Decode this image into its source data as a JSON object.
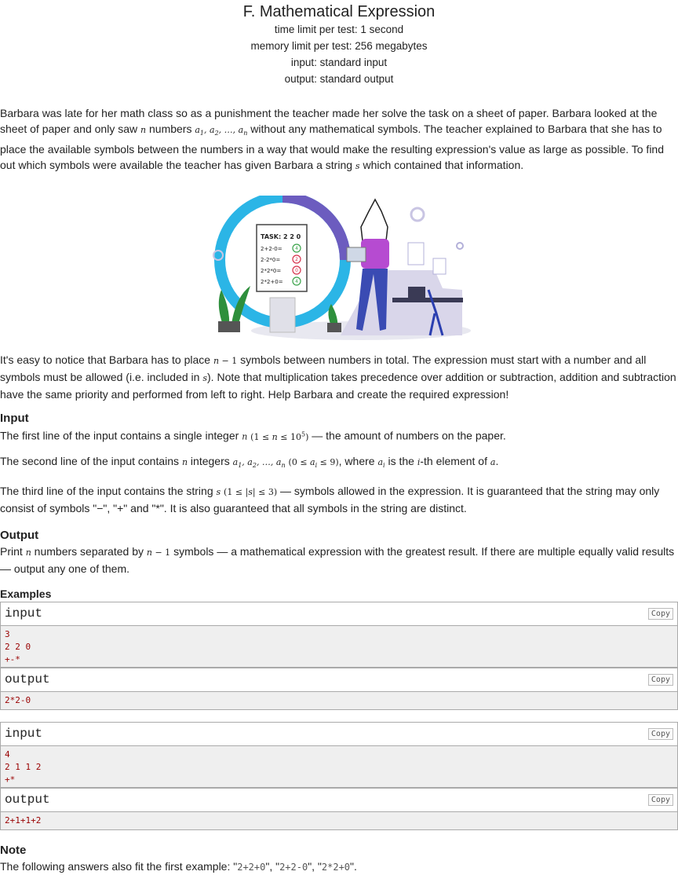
{
  "problem": {
    "title": "F. Mathematical Expression",
    "limits": [
      "time limit per test: 1 second",
      "memory limit per test: 256 megabytes",
      "input: standard input",
      "output: standard output"
    ]
  },
  "statement": {
    "p1_a": "Barbara was late for her math class so as a punishment the teacher made her solve the task on a sheet of paper. Barbara looked at the sheet of paper and only saw",
    "p1_b": "numbers",
    "p1_c": "without any mathematical symbols. The teacher explained to Barbara that she has to place the available symbols between the numbers in a way that would make the resulting expression's value as large as possible. To find out which symbols were available the teacher has given Barbara a string",
    "p1_d": "which contained that information.",
    "p2_a": "It's easy to notice that Barbara has to place",
    "p2_b": "symbols between numbers in total. The expression must start with a number and all symbols must be allowed (i.e. included in",
    "p2_c": "). Note that multiplication takes precedence over addition or subtraction, addition and subtraction have the same priority and performed from left to right. Help Barbara and create the required expression!"
  },
  "illustration": {
    "task_title": "TASK: 2 2 0",
    "rows": [
      {
        "expr": "2+2-0=",
        "ans": "4"
      },
      {
        "expr": "2-2*0=",
        "ans": "2"
      },
      {
        "expr": "2*2*0=",
        "ans": "0"
      },
      {
        "expr": "2*2+0=",
        "ans": "4"
      }
    ]
  },
  "input": {
    "heading": "Input",
    "l1_a": "The first line of the input contains a single integer",
    "l1_b": "— the amount of numbers on the paper.",
    "l2_a": "The second line of the input contains",
    "l2_b": "integers",
    "l2_c": ", where",
    "l2_d": "is the",
    "l2_e": "-th element of",
    "l3_a": "The third line of the input contains the string",
    "l3_b": "— symbols allowed in the expression. It is guaranteed that the string may only consist of symbols \"−\", \"+\" and \"*\". It is also guaranteed that all symbols in the string are distinct."
  },
  "output": {
    "heading": "Output",
    "l1_a": "Print",
    "l1_b": "numbers separated by",
    "l1_c": "symbols — a mathematical expression with the greatest result. If there are multiple equally valid results — output any one of them."
  },
  "examples": {
    "heading": "Examples",
    "copy_label": "Copy",
    "input_label": "input",
    "output_label": "output",
    "ex1_in": "3\n2 2 0\n+-*",
    "ex1_out": "2*2-0",
    "ex2_in": "4\n2 1 1 2\n+*",
    "ex2_out": "2+1+1+2"
  },
  "note": {
    "heading": "Note",
    "text_a": "The following answers also fit the first example: \"",
    "c1": "2+2+0",
    "sep1": "\", \"",
    "c2": "2+2-0",
    "sep2": "\", \"",
    "c3": "2*2+0",
    "end": "\"."
  }
}
